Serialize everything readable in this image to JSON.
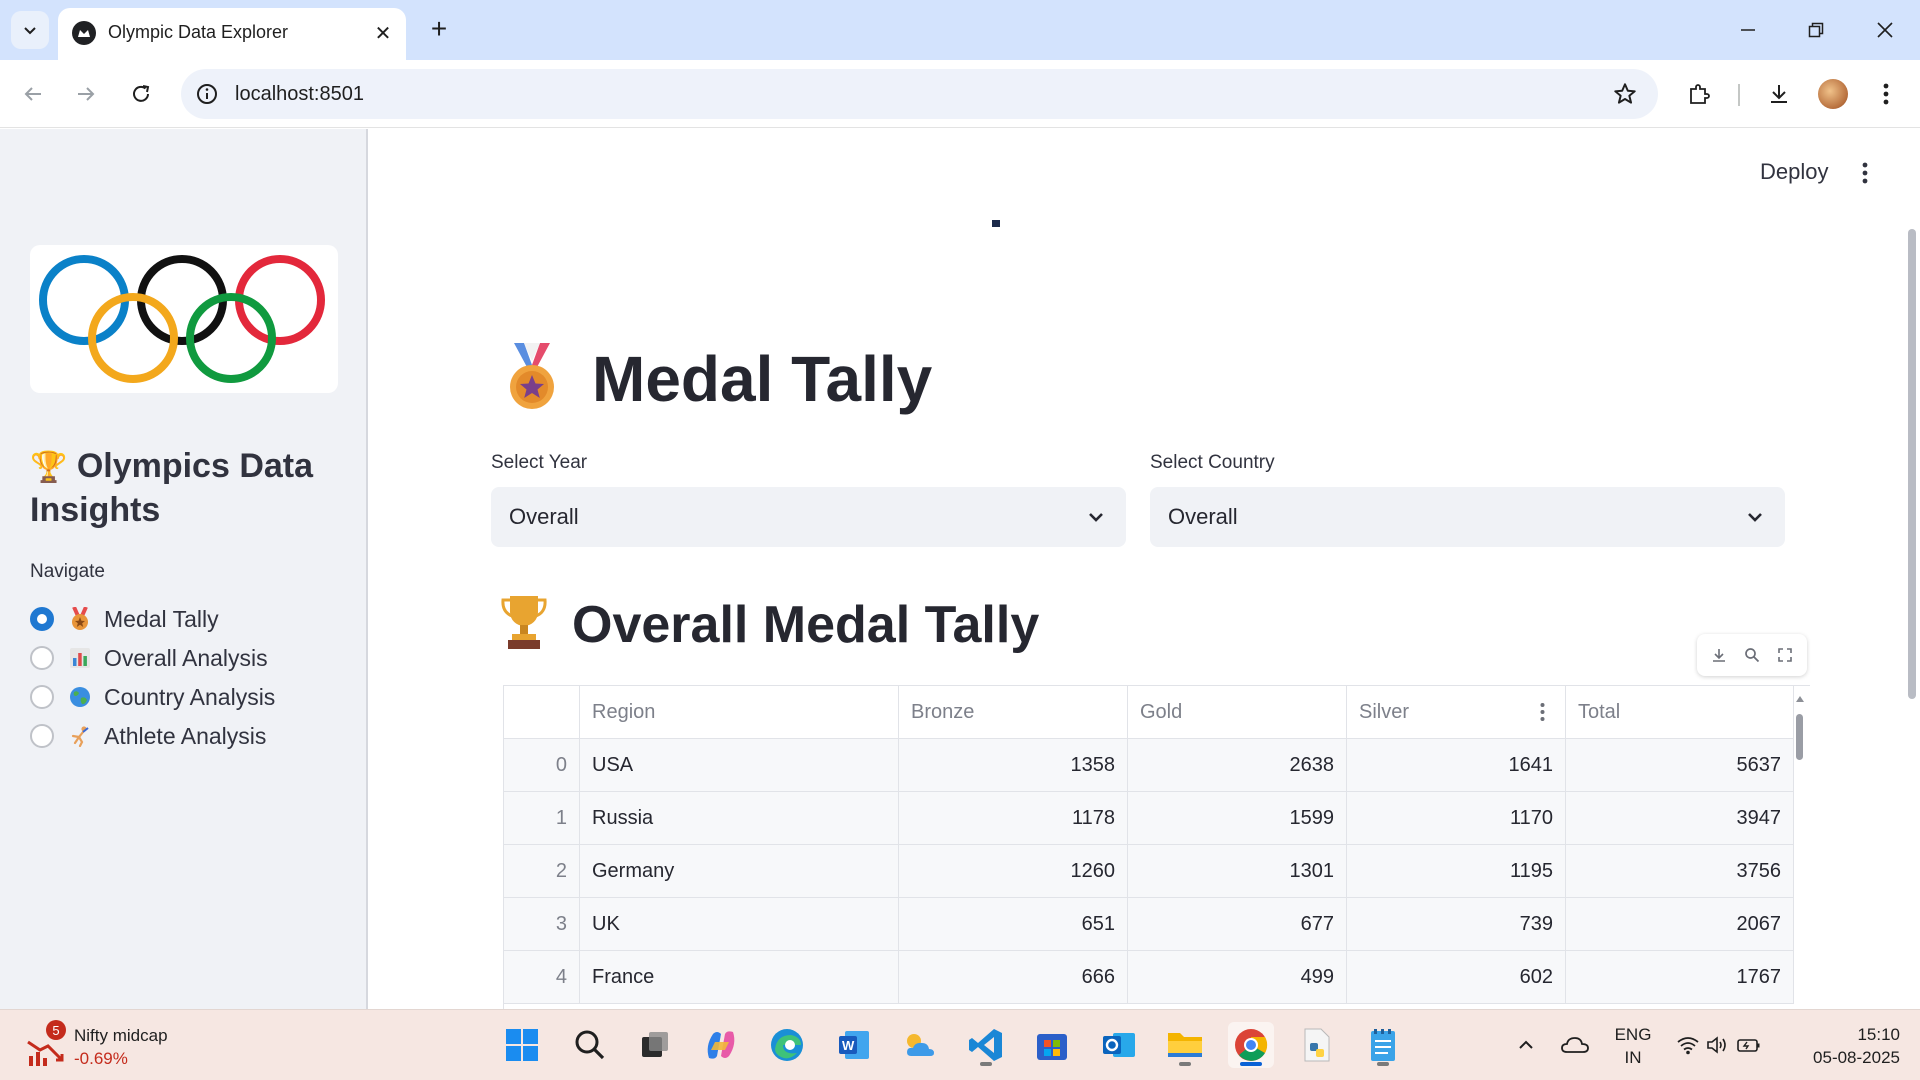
{
  "browser": {
    "tab_title": "Olympic Data Explorer",
    "url": "localhost:8501"
  },
  "sidebar": {
    "title": "Olympics Data Insights",
    "title_icon": "trophy-icon",
    "nav_label": "Navigate",
    "options": [
      {
        "label": "Medal Tally",
        "icon": "medal-icon",
        "selected": true
      },
      {
        "label": "Overall Analysis",
        "icon": "bar-chart-icon",
        "selected": false
      },
      {
        "label": "Country Analysis",
        "icon": "globe-icon",
        "selected": false
      },
      {
        "label": "Athlete Analysis",
        "icon": "athlete-icon",
        "selected": false
      }
    ]
  },
  "header": {
    "deploy_label": "Deploy"
  },
  "main": {
    "heading": "Medal Tally",
    "heading_icon": "medal-icon",
    "year_select": {
      "label": "Select Year",
      "value": "Overall"
    },
    "country_select": {
      "label": "Select Country",
      "value": "Overall"
    },
    "subheading": "Overall Medal Tally",
    "subheading_icon": "trophy-icon"
  },
  "table": {
    "columns": [
      "",
      "Region",
      "Bronze",
      "Gold",
      "Silver",
      "Total"
    ],
    "rows": [
      [
        "0",
        "USA",
        "1358",
        "2638",
        "1641",
        "5637"
      ],
      [
        "1",
        "Russia",
        "1178",
        "1599",
        "1170",
        "3947"
      ],
      [
        "2",
        "Germany",
        "1260",
        "1301",
        "1195",
        "3756"
      ],
      [
        "3",
        "UK",
        "651",
        "677",
        "739",
        "2067"
      ],
      [
        "4",
        "France",
        "666",
        "499",
        "602",
        "1767"
      ]
    ]
  },
  "taskbar": {
    "widget_name": "Nifty midcap",
    "widget_change": "-0.69%",
    "widget_badge": "5",
    "lang_line1": "ENG",
    "lang_line2": "IN",
    "time": "15:10",
    "date": "05-08-2025"
  },
  "colors": {
    "accent": "#1f78d1",
    "sidebar_bg": "#f0f2f6",
    "negative": "#c42b1c"
  }
}
